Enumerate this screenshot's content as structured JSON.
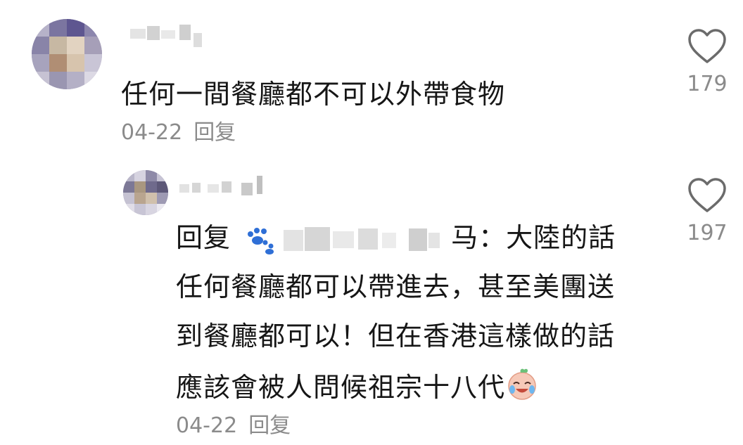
{
  "comments": [
    {
      "text": "任何一間餐廳都不可以外帶食物",
      "date": "04-22",
      "reply_label": "回复",
      "like_count": "179",
      "avatar_icon": "pixelated-avatar",
      "like_icon": "heart-outline-icon"
    }
  ],
  "reply": {
    "prefix": "回复",
    "mention_suffix": "马：",
    "line1_tail": "大陸的話",
    "line2": "任何餐廳都可以帶進去，甚至美團送",
    "line3": "到餐廳都可以！但在香港這樣做的話",
    "line4": "應該會被人問候祖宗十八代",
    "emoji_icon": "crying-laughing-face-icon",
    "paw_icon": "paw-icon",
    "date": "04-22",
    "reply_label": "回复",
    "like_count": "197",
    "like_icon": "heart-outline-icon"
  },
  "colors": {
    "text": "#161616",
    "meta": "#8b8b8b",
    "paw": "#2f6fd6"
  }
}
